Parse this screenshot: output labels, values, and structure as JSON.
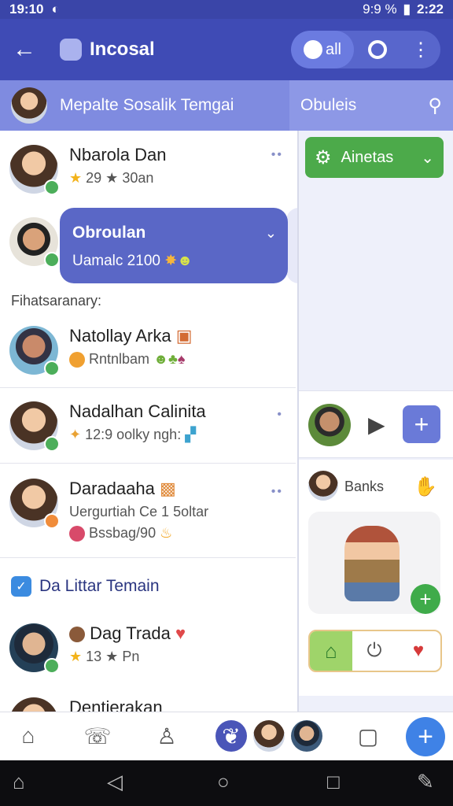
{
  "status": {
    "time_left": "19:10",
    "battery": "9:9 %",
    "time_right": "2:22"
  },
  "appbar": {
    "title": "Incosal",
    "seg_label": "all"
  },
  "subbar": {
    "left_label": "Mepalte Sosalik Temgai",
    "right_label": "Obuleis"
  },
  "rows": [
    {
      "name": "Nbarola Dan",
      "sub": "29  ★ 30an"
    },
    {
      "name": "Obroulan",
      "sub": "Uamalc 2100"
    },
    {
      "name": "Natollay Arka",
      "sub": "Rntnlbam"
    },
    {
      "name": "Nadalhan Calinita",
      "sub": "12:9 oolky ngh:"
    },
    {
      "name": "Daradaaha",
      "sub": "Uergurtiah Ce 1 5oltar",
      "sub2": "Bssbag/90"
    },
    {
      "name": "Dag Trada",
      "sub": "13  ★ Pn"
    },
    {
      "name": "Dentierakan"
    }
  ],
  "section1": "Fihatsaranary:",
  "section2": "Da Littar Temain",
  "right": {
    "green_button": "Ainetas",
    "contact_label": "Banks"
  },
  "colors": {
    "primary": "#3f4bb5",
    "accent": "#4caa4a",
    "fab": "#3f82e6"
  }
}
